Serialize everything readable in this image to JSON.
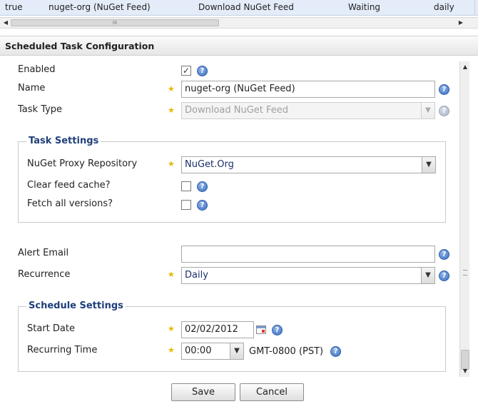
{
  "grid": {
    "row": {
      "enabled": "true",
      "name": "nuget-org (NuGet Feed)",
      "type": "Download NuGet Feed",
      "status": "Waiting",
      "schedule": "daily"
    },
    "scrollbar": {
      "left_arrow": "◀",
      "right_arrow": "▶",
      "thumb_grip": "III"
    }
  },
  "panel": {
    "title": "Scheduled Task Configuration"
  },
  "form": {
    "enabled": {
      "label": "Enabled",
      "checked": true,
      "check_glyph": "✓"
    },
    "name": {
      "label": "Name",
      "value": "nuget-org (NuGet Feed)"
    },
    "task_type": {
      "label": "Task Type",
      "value": "Download NuGet Feed",
      "disabled": true
    },
    "task_settings": {
      "legend": "Task Settings",
      "repository": {
        "label": "NuGet Proxy Repository",
        "value": "NuGet.Org"
      },
      "clear_cache": {
        "label": "Clear feed cache?",
        "checked": false
      },
      "fetch_all": {
        "label": "Fetch all versions?",
        "checked": false
      }
    },
    "alert_email": {
      "label": "Alert Email",
      "value": ""
    },
    "recurrence": {
      "label": "Recurrence",
      "value": "Daily"
    },
    "schedule_settings": {
      "legend": "Schedule Settings",
      "start_date": {
        "label": "Start Date",
        "value": "02/02/2012"
      },
      "recurring_time": {
        "label": "Recurring Time",
        "value": "00:00",
        "timezone": "GMT-0800 (PST)"
      }
    }
  },
  "buttons": {
    "save": "Save",
    "cancel": "Cancel"
  },
  "icons": {
    "required": "★",
    "help": "?",
    "dropdown": "▼",
    "scroll_up": "▲",
    "scroll_down": "▼"
  },
  "colors": {
    "grid_row_bg": "#e3ecf8",
    "legend_text": "#1f3f7a",
    "required_star": "#e6b800",
    "help_icon": "#3b6fc1"
  }
}
